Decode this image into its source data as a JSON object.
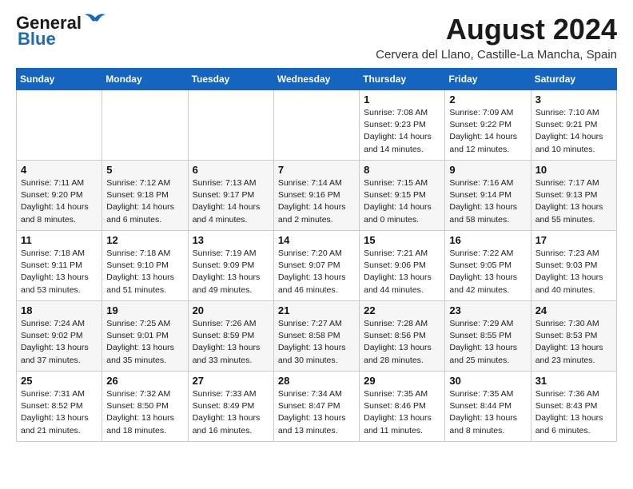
{
  "header": {
    "logo_line1": "General",
    "logo_line2": "Blue",
    "main_title": "August 2024",
    "subtitle": "Cervera del Llano, Castille-La Mancha, Spain"
  },
  "columns": [
    "Sunday",
    "Monday",
    "Tuesday",
    "Wednesday",
    "Thursday",
    "Friday",
    "Saturday"
  ],
  "weeks": [
    [
      {
        "day": "",
        "text": ""
      },
      {
        "day": "",
        "text": ""
      },
      {
        "day": "",
        "text": ""
      },
      {
        "day": "",
        "text": ""
      },
      {
        "day": "1",
        "text": "Sunrise: 7:08 AM\nSunset: 9:23 PM\nDaylight: 14 hours\nand 14 minutes."
      },
      {
        "day": "2",
        "text": "Sunrise: 7:09 AM\nSunset: 9:22 PM\nDaylight: 14 hours\nand 12 minutes."
      },
      {
        "day": "3",
        "text": "Sunrise: 7:10 AM\nSunset: 9:21 PM\nDaylight: 14 hours\nand 10 minutes."
      }
    ],
    [
      {
        "day": "4",
        "text": "Sunrise: 7:11 AM\nSunset: 9:20 PM\nDaylight: 14 hours\nand 8 minutes."
      },
      {
        "day": "5",
        "text": "Sunrise: 7:12 AM\nSunset: 9:18 PM\nDaylight: 14 hours\nand 6 minutes."
      },
      {
        "day": "6",
        "text": "Sunrise: 7:13 AM\nSunset: 9:17 PM\nDaylight: 14 hours\nand 4 minutes."
      },
      {
        "day": "7",
        "text": "Sunrise: 7:14 AM\nSunset: 9:16 PM\nDaylight: 14 hours\nand 2 minutes."
      },
      {
        "day": "8",
        "text": "Sunrise: 7:15 AM\nSunset: 9:15 PM\nDaylight: 14 hours\nand 0 minutes."
      },
      {
        "day": "9",
        "text": "Sunrise: 7:16 AM\nSunset: 9:14 PM\nDaylight: 13 hours\nand 58 minutes."
      },
      {
        "day": "10",
        "text": "Sunrise: 7:17 AM\nSunset: 9:13 PM\nDaylight: 13 hours\nand 55 minutes."
      }
    ],
    [
      {
        "day": "11",
        "text": "Sunrise: 7:18 AM\nSunset: 9:11 PM\nDaylight: 13 hours\nand 53 minutes."
      },
      {
        "day": "12",
        "text": "Sunrise: 7:18 AM\nSunset: 9:10 PM\nDaylight: 13 hours\nand 51 minutes."
      },
      {
        "day": "13",
        "text": "Sunrise: 7:19 AM\nSunset: 9:09 PM\nDaylight: 13 hours\nand 49 minutes."
      },
      {
        "day": "14",
        "text": "Sunrise: 7:20 AM\nSunset: 9:07 PM\nDaylight: 13 hours\nand 46 minutes."
      },
      {
        "day": "15",
        "text": "Sunrise: 7:21 AM\nSunset: 9:06 PM\nDaylight: 13 hours\nand 44 minutes."
      },
      {
        "day": "16",
        "text": "Sunrise: 7:22 AM\nSunset: 9:05 PM\nDaylight: 13 hours\nand 42 minutes."
      },
      {
        "day": "17",
        "text": "Sunrise: 7:23 AM\nSunset: 9:03 PM\nDaylight: 13 hours\nand 40 minutes."
      }
    ],
    [
      {
        "day": "18",
        "text": "Sunrise: 7:24 AM\nSunset: 9:02 PM\nDaylight: 13 hours\nand 37 minutes."
      },
      {
        "day": "19",
        "text": "Sunrise: 7:25 AM\nSunset: 9:01 PM\nDaylight: 13 hours\nand 35 minutes."
      },
      {
        "day": "20",
        "text": "Sunrise: 7:26 AM\nSunset: 8:59 PM\nDaylight: 13 hours\nand 33 minutes."
      },
      {
        "day": "21",
        "text": "Sunrise: 7:27 AM\nSunset: 8:58 PM\nDaylight: 13 hours\nand 30 minutes."
      },
      {
        "day": "22",
        "text": "Sunrise: 7:28 AM\nSunset: 8:56 PM\nDaylight: 13 hours\nand 28 minutes."
      },
      {
        "day": "23",
        "text": "Sunrise: 7:29 AM\nSunset: 8:55 PM\nDaylight: 13 hours\nand 25 minutes."
      },
      {
        "day": "24",
        "text": "Sunrise: 7:30 AM\nSunset: 8:53 PM\nDaylight: 13 hours\nand 23 minutes."
      }
    ],
    [
      {
        "day": "25",
        "text": "Sunrise: 7:31 AM\nSunset: 8:52 PM\nDaylight: 13 hours\nand 21 minutes."
      },
      {
        "day": "26",
        "text": "Sunrise: 7:32 AM\nSunset: 8:50 PM\nDaylight: 13 hours\nand 18 minutes."
      },
      {
        "day": "27",
        "text": "Sunrise: 7:33 AM\nSunset: 8:49 PM\nDaylight: 13 hours\nand 16 minutes."
      },
      {
        "day": "28",
        "text": "Sunrise: 7:34 AM\nSunset: 8:47 PM\nDaylight: 13 hours\nand 13 minutes."
      },
      {
        "day": "29",
        "text": "Sunrise: 7:35 AM\nSunset: 8:46 PM\nDaylight: 13 hours\nand 11 minutes."
      },
      {
        "day": "30",
        "text": "Sunrise: 7:35 AM\nSunset: 8:44 PM\nDaylight: 13 hours\nand 8 minutes."
      },
      {
        "day": "31",
        "text": "Sunrise: 7:36 AM\nSunset: 8:43 PM\nDaylight: 13 hours\nand 6 minutes."
      }
    ]
  ]
}
